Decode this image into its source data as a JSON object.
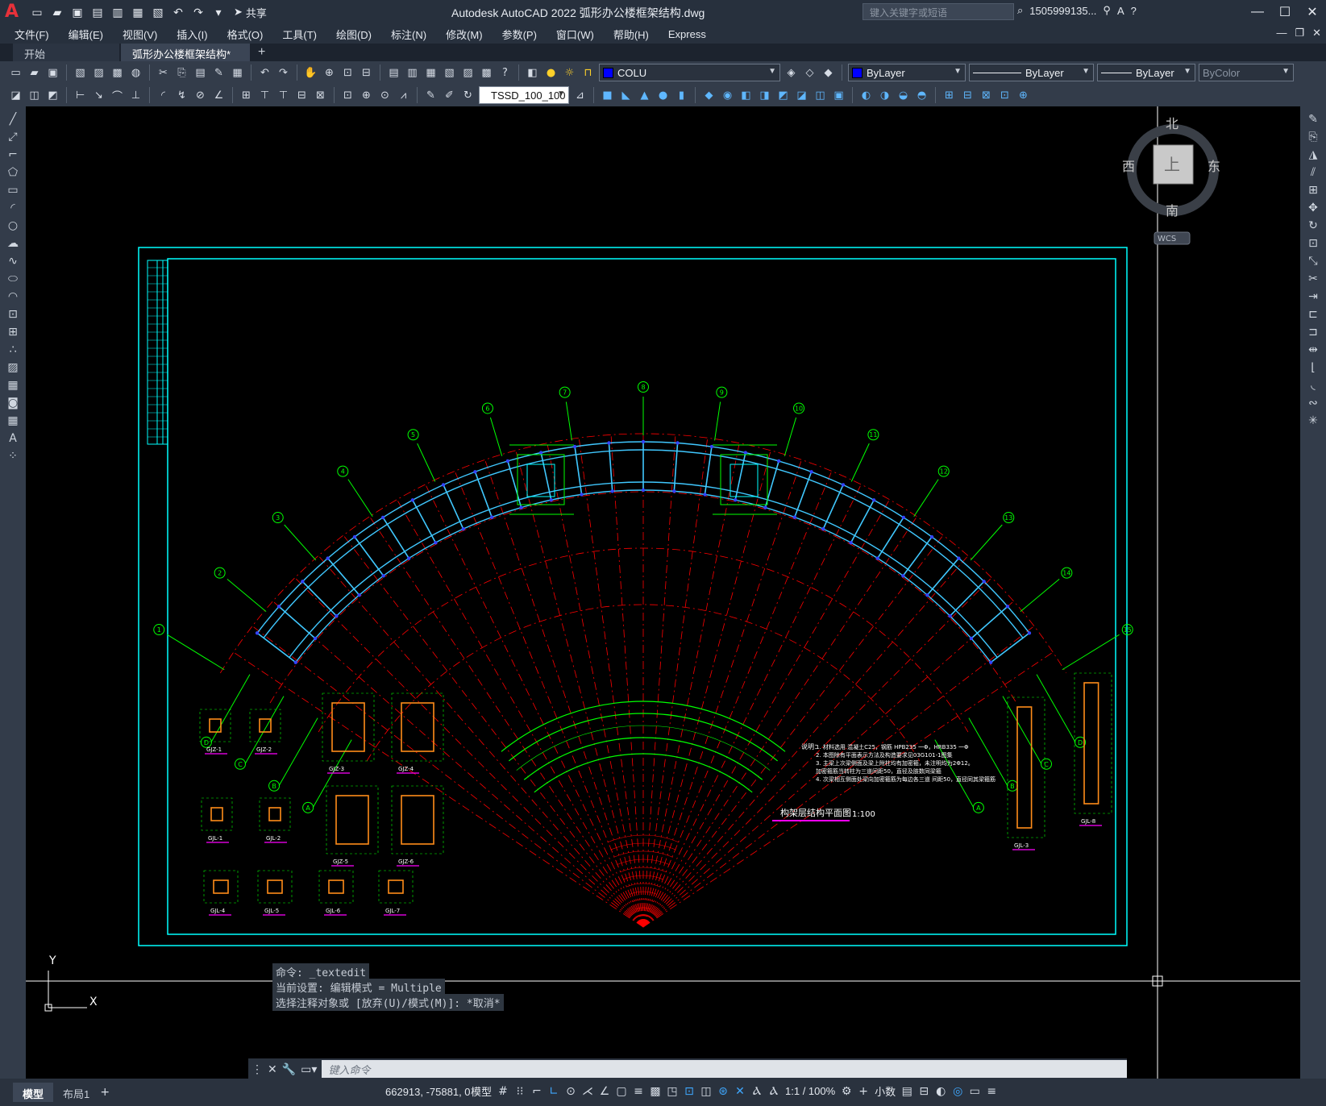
{
  "titlebar": {
    "app_logo": "A",
    "share_label": "共享",
    "title": "Autodesk AutoCAD 2022    弧形办公楼框架结构.dwg",
    "search_placeholder": "键入关键字或短语",
    "user": "1505999135...",
    "help": "?"
  },
  "menu": [
    "文件(F)",
    "编辑(E)",
    "视图(V)",
    "插入(I)",
    "格式(O)",
    "工具(T)",
    "绘图(D)",
    "标注(N)",
    "修改(M)",
    "参数(P)",
    "窗口(W)",
    "帮助(H)",
    "Express"
  ],
  "tabs": {
    "start": "开始",
    "active": "弧形办公楼框架结构*",
    "add": "+"
  },
  "toolbar": {
    "layer": "COLU",
    "color": "ByLayer",
    "linetype": "ByLayer",
    "lineweight": "ByLayer",
    "plotstyle": "ByColor",
    "textstyle": "TSSD_100_100"
  },
  "viewcube": {
    "north": "北",
    "south": "南",
    "west": "西",
    "east": "东",
    "face": "上",
    "wcs": "WCS"
  },
  "drawing": {
    "axis_numbers": [
      "1",
      "2",
      "3",
      "4",
      "5",
      "6",
      "7",
      "8",
      "9",
      "10",
      "11",
      "12",
      "13",
      "14",
      "15"
    ],
    "axis_letters": [
      "A",
      "B",
      "C",
      "D"
    ],
    "plan_title": "构架层结构平面图",
    "plan_scale": "1:100",
    "notes_title": "说明：",
    "notes": [
      "1. 材料选用 混凝土C25，钢筋 HPB235 一Φ，HRB335 一Φ",
      "2. 本图除有平面表示方法及构造要求见03G101-1图集",
      "3. 主梁上次梁侧面及梁上附柱均有加密箍，未注明均为2Φ12。",
      "   加密箍筋当转柱为三道间距50，直径及肢数同梁箍",
      "4. 次梁相互侧面处梁向加密箍筋为每边各三道 间距50，直径同其梁箍筋"
    ],
    "col_labels": [
      "GJZ-1",
      "GJZ-2",
      "GJZ-3",
      "GJZ-4",
      "GJL-1",
      "GJL-2",
      "GJZ-5",
      "GJZ-6",
      "GJL-4",
      "GJL-5",
      "GJL-6",
      "GJL-7",
      "GJL-3",
      "GJL-8"
    ],
    "ucs_x": "X",
    "ucs_y": "Y"
  },
  "command": {
    "history": [
      "命令: _textedit",
      "当前设置: 编辑模式 = Multiple",
      "选择注释对象或 [放弃(U)/模式(M)]: *取消*"
    ],
    "placeholder": "键入命令"
  },
  "status": {
    "layout_tabs": [
      "模型",
      "布局1"
    ],
    "coords": "662913, -75881, 0",
    "model_label": "模型",
    "scale": "1:1 / 100%",
    "units": "小数"
  }
}
